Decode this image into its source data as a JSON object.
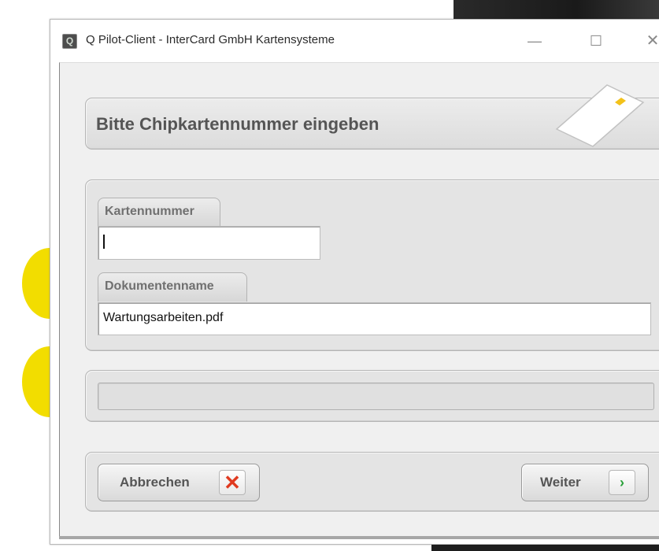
{
  "window": {
    "title": "Q Pilot-Client - InterCard GmbH Kartensysteme",
    "app_icon_glyph": "Q",
    "minimize_glyph": "—",
    "maximize_glyph": "☐",
    "close_glyph": "✕"
  },
  "header": {
    "title": "Bitte Chipkartennummer eingeben",
    "icon": "chip-card-icon"
  },
  "form": {
    "card_number": {
      "label": "Kartennummer",
      "value": ""
    },
    "document_name": {
      "label": "Dokumentenname",
      "value": "Wartungsarbeiten.pdf"
    }
  },
  "progress": {
    "value": 0
  },
  "buttons": {
    "cancel": {
      "label": "Abbrechen",
      "icon": "x-icon",
      "icon_glyph": "✕"
    },
    "next": {
      "label": "Weiter",
      "icon": "chevron-right-icon",
      "icon_glyph": "›"
    }
  },
  "colors": {
    "accent_yellow": "#f2dd00",
    "cancel_icon": "#e03a20",
    "next_icon": "#2aa13a",
    "chip": "#f3c21a"
  }
}
